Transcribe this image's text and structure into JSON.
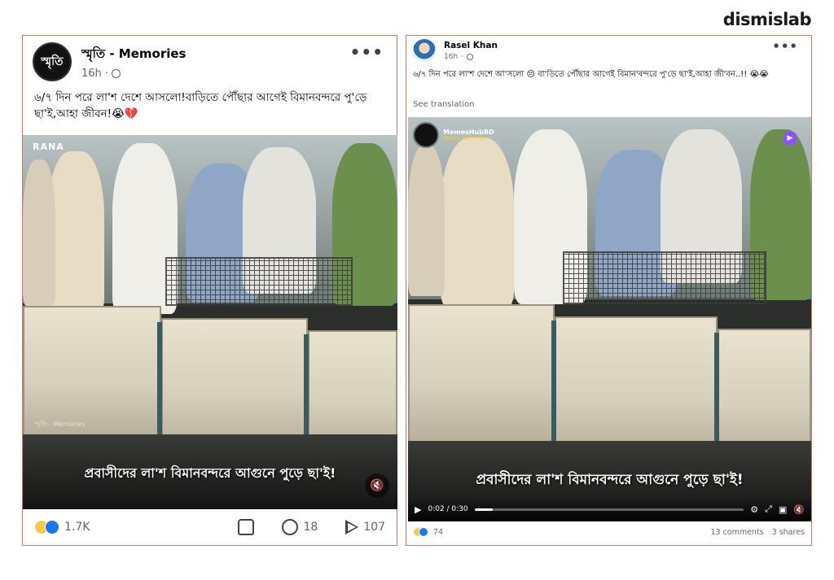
{
  "brand": "dismislab",
  "left_post": {
    "page_name": "স্মৃতি - Memories",
    "avatar_text": "স্মৃতি",
    "time": "16h",
    "caption": "৬/৭ দিন পরে লা'শ দেশে আসলো!বাড়িতে পৌঁছার আগেই বিমানবন্দরে পু'ড়ে ছা'ই,আহা জীবন!😭💔",
    "video": {
      "corner_label": "RANA",
      "watermark": "স্মৃতি - Memories",
      "overlay_text": "প্রবাসীদের লা'শ বিমানবন্দরে আগুনে পুড়ে ছা'ই!"
    },
    "reactions": "1.7K",
    "comments": "18",
    "shares": "107"
  },
  "right_post": {
    "page_name": "Rasel Khan",
    "time": "16h",
    "caption": "৬/৭ দিন পরে লা'শ দেশে আ'সলো 😔  বা'ড়িতে পৌঁছার আগেই বিমান'বন্দরে পু'ড়ে ছা'ই,আহা জী'বন..!! 😭😭",
    "see_translation": "See translation",
    "video": {
      "channel_name": "MemesHubBD",
      "channel_sub": "Memes Hub Page",
      "overlay_text": "প্রবাসীদের লা'শ বিমানবন্দরে আগুনে পুড়ে ছা'ই!",
      "time_display": "0:02 / 0:30",
      "progress": 0.067
    },
    "reactions": "74",
    "comments": "13 comments",
    "shares": "3 shares"
  }
}
